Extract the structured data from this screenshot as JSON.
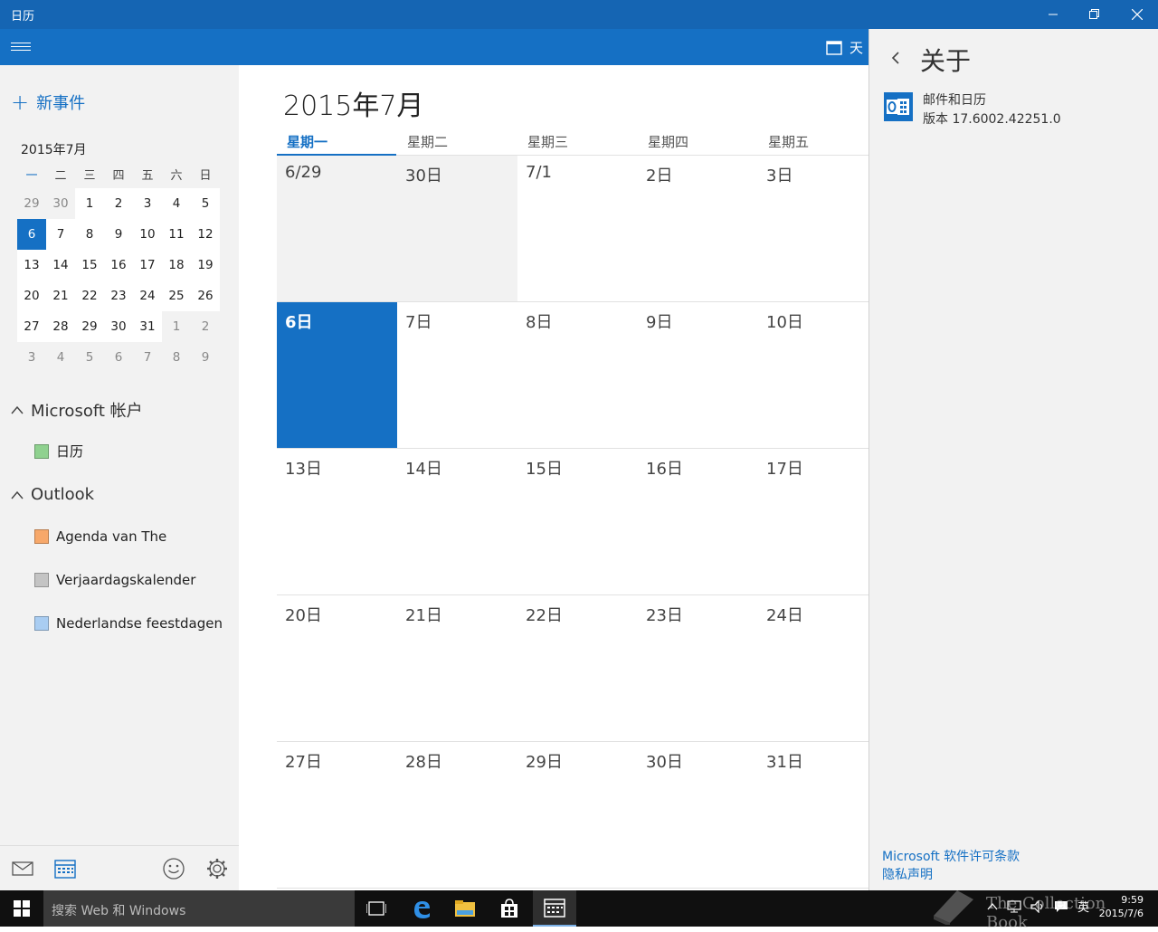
{
  "window": {
    "title": "日历"
  },
  "header": {
    "view_label": "天"
  },
  "left": {
    "new_event": "新事件",
    "mini_title": "2015年7月",
    "mini_weekdays": [
      "一",
      "二",
      "三",
      "四",
      "五",
      "六",
      "日"
    ],
    "mini_weeks": [
      [
        "29",
        "30",
        "1",
        "2",
        "3",
        "4",
        "5"
      ],
      [
        "6",
        "7",
        "8",
        "9",
        "10",
        "11",
        "12"
      ],
      [
        "13",
        "14",
        "15",
        "16",
        "17",
        "18",
        "19"
      ],
      [
        "20",
        "21",
        "22",
        "23",
        "24",
        "25",
        "26"
      ],
      [
        "27",
        "28",
        "29",
        "30",
        "31",
        "1",
        "2"
      ],
      [
        "3",
        "4",
        "5",
        "6",
        "7",
        "8",
        "9"
      ]
    ],
    "accounts": [
      {
        "name": "Microsoft 帐户",
        "calendars": [
          {
            "name": "日历",
            "color": "#8fd18f"
          }
        ]
      },
      {
        "name": "Outlook",
        "calendars": [
          {
            "name": "Agenda van The",
            "color": "#f7a86a"
          },
          {
            "name": "Verjaardagskalender",
            "color": "#c4c4c4"
          },
          {
            "name": "Nederlandse feestdagen",
            "color": "#a9cdf2"
          }
        ]
      }
    ]
  },
  "month": {
    "title": "2015年7月",
    "weekdays": [
      "星期一",
      "星期二",
      "星期三",
      "星期四",
      "星期五"
    ],
    "weeks": [
      [
        "6/29",
        "30日",
        "7/1",
        "2日",
        "3日"
      ],
      [
        "6日",
        "7日",
        "8日",
        "9日",
        "10日"
      ],
      [
        "13日",
        "14日",
        "15日",
        "16日",
        "17日"
      ],
      [
        "20日",
        "21日",
        "22日",
        "23日",
        "24日"
      ],
      [
        "27日",
        "28日",
        "29日",
        "30日",
        "31日"
      ]
    ]
  },
  "about": {
    "title": "关于",
    "app_name": "邮件和日历",
    "version": "版本 17.6002.42251.0",
    "license_link": "Microsoft 软件许可条款",
    "privacy_link": "隐私声明"
  },
  "taskbar": {
    "search_placeholder": "搜索 Web 和 Windows",
    "ime": "英",
    "time": "9:59",
    "date": "2015/7/6"
  },
  "watermark": "The Collection Book",
  "colors": {
    "accent": "#1570c4",
    "titlebar": "#1565b3"
  }
}
